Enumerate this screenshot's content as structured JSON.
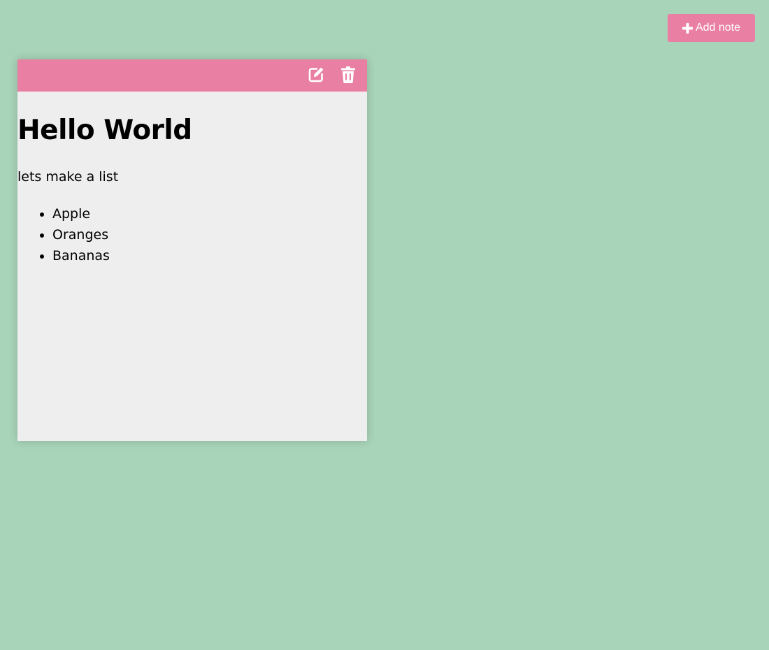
{
  "toolbar": {
    "add_label": "Add note",
    "add_icon": "plus-icon"
  },
  "note": {
    "edit_icon": "edit-icon",
    "delete_icon": "trash-icon",
    "title": "Hello World",
    "text": "lets make a list",
    "items": [
      "Apple",
      "Oranges",
      "Bananas"
    ]
  },
  "colors": {
    "background": "#a8d4b9",
    "accent": "#e97fa2",
    "note_body": "#eeeeee"
  }
}
